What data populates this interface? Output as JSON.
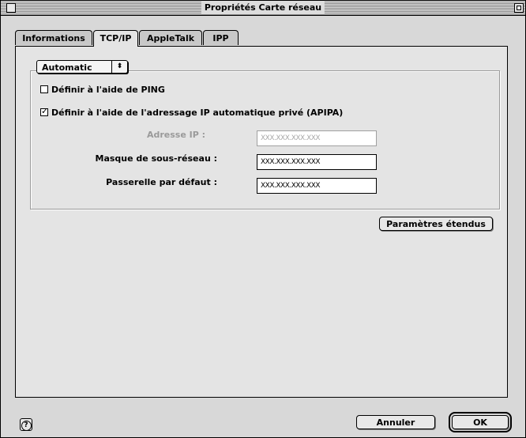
{
  "window": {
    "title": "Propriétés Carte réseau"
  },
  "tabs": [
    {
      "label": "Informations",
      "active": false
    },
    {
      "label": "TCP/IP",
      "active": true
    },
    {
      "label": "AppleTalk",
      "active": false
    },
    {
      "label": "IPP",
      "active": false
    }
  ],
  "config_method": {
    "selected": "Automatic",
    "arrows_glyph": "⬍"
  },
  "options": {
    "ping": {
      "label": "Définir à l'aide de PING",
      "checked": false
    },
    "apipa": {
      "label": "Définir à l'aide de l'adressage IP automatique privé  (APIPA)",
      "checked": true
    }
  },
  "fields": {
    "ip_address": {
      "label": "Adresse IP :",
      "value": "XXX.XXX.XXX.XXX",
      "disabled": true
    },
    "subnet_mask": {
      "label": "Masque de sous-réseau :",
      "value": "XXX.XXX.XXX.XXX",
      "disabled": false
    },
    "gateway": {
      "label": "Passerelle par défaut :",
      "value": "XXX.XXX.XXX.XXX",
      "disabled": false
    }
  },
  "buttons": {
    "advanced": "Paramètres étendus",
    "cancel": "Annuler",
    "ok": "OK",
    "help_glyph": "?"
  }
}
